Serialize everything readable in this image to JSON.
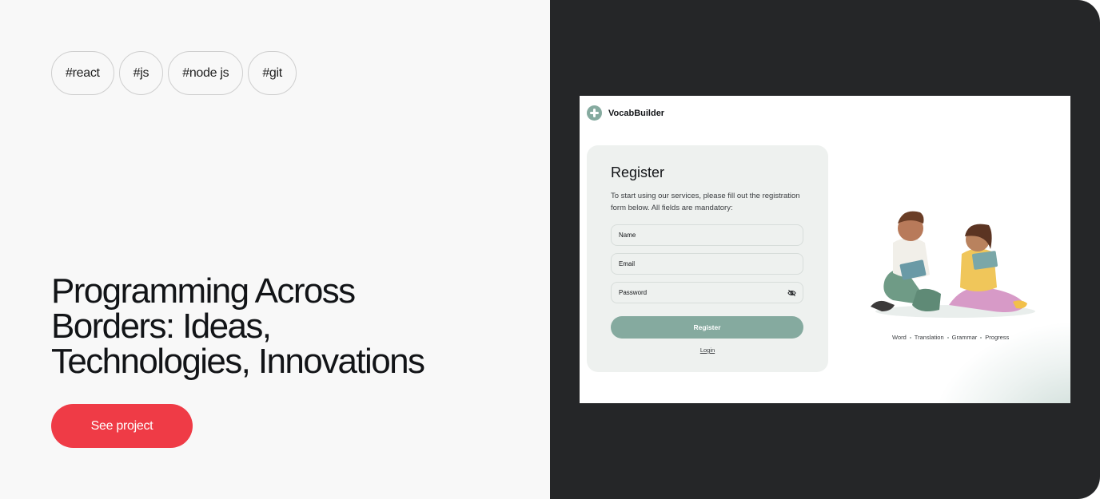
{
  "tags": [
    "#react",
    "#js",
    "#node js",
    "#git"
  ],
  "headline": "Programming Across Borders: Ideas, Technologies, Innovations",
  "cta_label": "See project",
  "preview": {
    "brand_name": "VocabBuilder",
    "form": {
      "title": "Register",
      "description": "To start using our services, please fill out the registration form below. All fields are mandatory:",
      "fields": {
        "name_placeholder": "Name",
        "email_placeholder": "Email",
        "password_placeholder": "Password"
      },
      "submit_label": "Register",
      "login_label": "Login"
    },
    "features": [
      "Word",
      "Translation",
      "Grammar",
      "Progress"
    ]
  },
  "colors": {
    "accent": "#ef3b46",
    "brand_green": "#85aa9f",
    "dark_panel": "#252628",
    "light_panel": "#f8f8f8"
  },
  "icons": {
    "password_toggle": "eye-off-icon",
    "brand_logo": "vocabbuilder-logo-icon"
  }
}
